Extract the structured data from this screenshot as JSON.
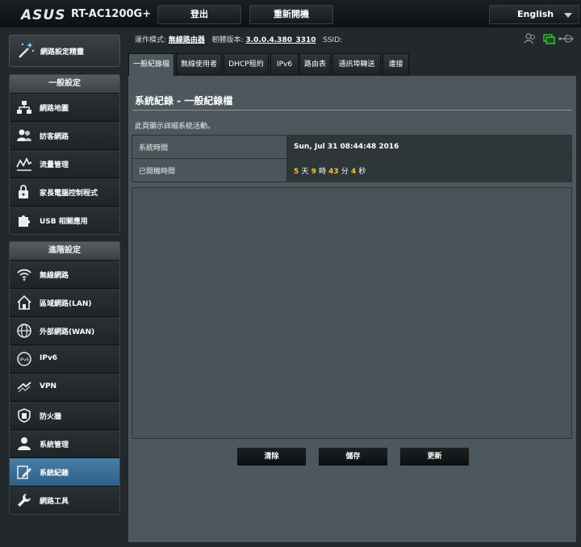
{
  "header": {
    "brand": "ASUS",
    "model": "RT-AC1200G+",
    "logout_label": "登出",
    "reboot_label": "重新開機",
    "language": "English"
  },
  "sidebar": {
    "quick_setup": "網路設定精靈",
    "general": {
      "heading": "一般設定",
      "items": [
        {
          "label": "網路地圖",
          "icon": "network-map-icon"
        },
        {
          "label": "訪客網路",
          "icon": "guest-users-icon"
        },
        {
          "label": "流量管理",
          "icon": "traffic-chart-icon"
        },
        {
          "label": "家長電腦控制程式",
          "icon": "parental-lock-icon"
        },
        {
          "label": "USB 相關應用",
          "icon": "puzzle-icon"
        }
      ]
    },
    "advanced": {
      "heading": "進階設定",
      "items": [
        {
          "label": "無線網路",
          "icon": "wifi-icon"
        },
        {
          "label": "區域網路(LAN)",
          "icon": "home-icon"
        },
        {
          "label": "外部網路(WAN)",
          "icon": "globe-icon"
        },
        {
          "label": "IPv6",
          "icon": "ipv6-globe-icon"
        },
        {
          "label": "VPN",
          "icon": "vpn-icon"
        },
        {
          "label": "防火牆",
          "icon": "shield-icon"
        },
        {
          "label": "系統管理",
          "icon": "admin-user-icon"
        },
        {
          "label": "系統紀錄",
          "icon": "log-edit-icon"
        },
        {
          "label": "網路工具",
          "icon": "wrench-icon"
        }
      ]
    }
  },
  "status": {
    "mode_label": "運作模式:",
    "mode_value": "無線路由器",
    "firmware_label": "韌體版本:",
    "firmware_value": "3.0.0.4.380_3310",
    "ssid_label": "SSID:"
  },
  "tabs": [
    "一般紀錄檔",
    "無線使用者",
    "DHCP租約",
    "IPv6",
    "路由表",
    "通訊埠轉送",
    "連接"
  ],
  "page": {
    "title": "系統紀錄 - 一般紀錄檔",
    "description": "此頁顯示詳細系統活動。",
    "system_time_label": "系統時間",
    "system_time_value": "Sun, Jul 31 08:44:48 2016",
    "uptime_label": "已開機時間",
    "uptime": {
      "days": "5",
      "days_unit": "天",
      "hours": "9",
      "hours_unit": "時",
      "minutes": "43",
      "minutes_unit": "分",
      "seconds": "4",
      "seconds_unit": "秒"
    },
    "log_content": ""
  },
  "actions": {
    "clear": "清除",
    "save": "儲存",
    "refresh": "更新"
  },
  "colors": {
    "accent": "#3d79a6",
    "highlight_number": "#f2c13a"
  }
}
